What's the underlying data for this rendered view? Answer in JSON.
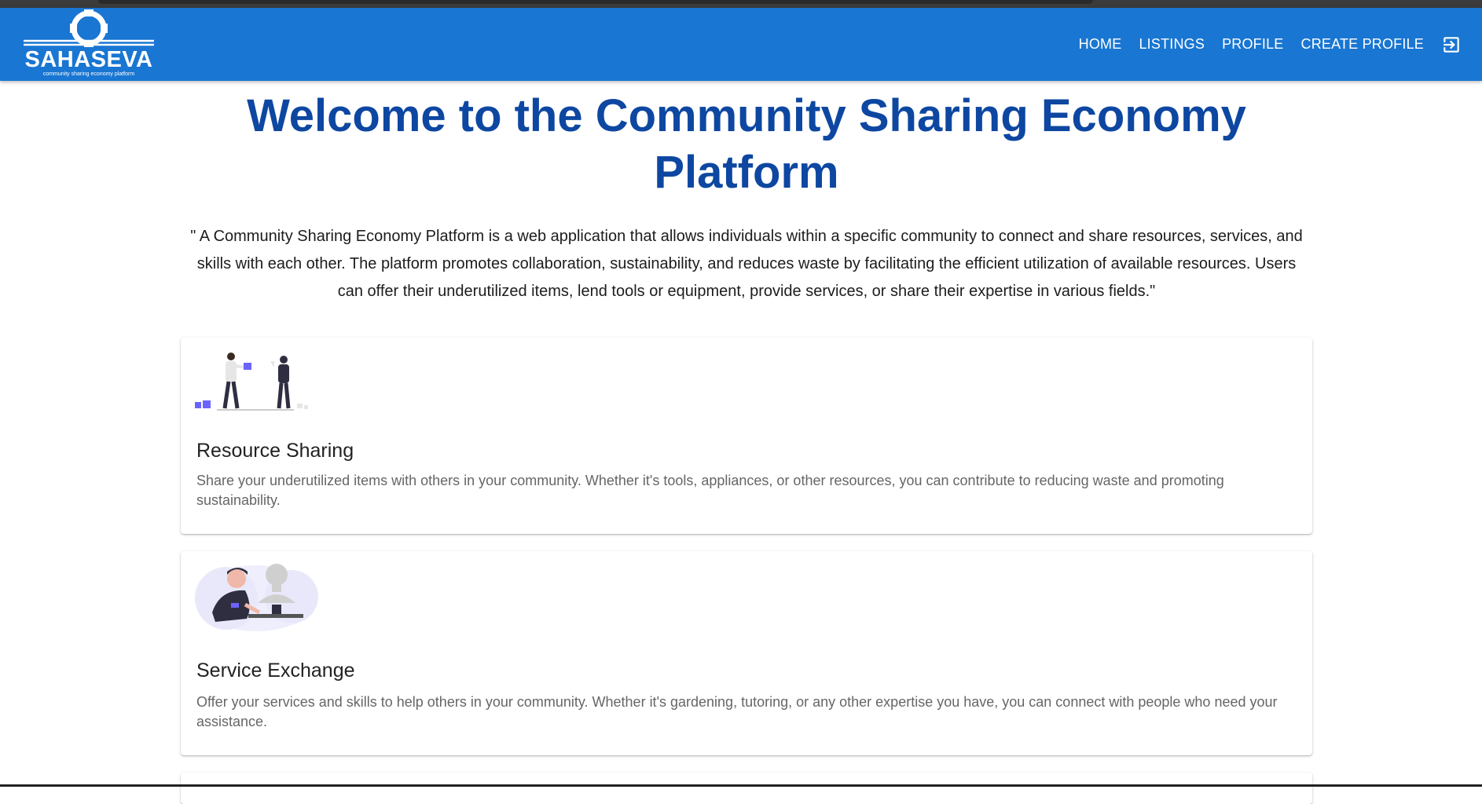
{
  "brand": {
    "name": "SAHASEVA",
    "tagline": "community sharing economy platform",
    "bar_color": "#1976d2"
  },
  "nav": {
    "items": [
      {
        "label": "HOME",
        "name": "nav-home"
      },
      {
        "label": "LISTINGS",
        "name": "nav-listings"
      },
      {
        "label": "PROFILE",
        "name": "nav-profile"
      },
      {
        "label": "CREATE PROFILE",
        "name": "nav-create-profile"
      }
    ],
    "logout_icon": "logout-icon"
  },
  "hero": {
    "title": "Welcome to the Community Sharing Economy Platform",
    "description": "\" A Community Sharing Economy Platform is a web application that allows individuals within a specific community to connect and share resources, services, and skills with each other. The platform promotes collaboration, sustainability, and reduces waste by facilitating the efficient utilization of available resources. Users can offer their underutilized items, lend tools or equipment, provide services, or share their expertise in various fields.\"",
    "title_color": "#0d47a1"
  },
  "cards": [
    {
      "title": "Resource Sharing",
      "body": "Share your underutilized items with others in your community. Whether it's tools, appliances, or other resources, you can contribute to reducing waste and promoting sustainability.",
      "illustration": "people-sharing-illustration"
    },
    {
      "title": "Service Exchange",
      "body": "Offer your services and skills to help others in your community. Whether it's gardening, tutoring, or any other expertise you have, you can connect with people who need your assistance.",
      "illustration": "sculptor-illustration"
    }
  ],
  "accent_color": "#6c63ff"
}
